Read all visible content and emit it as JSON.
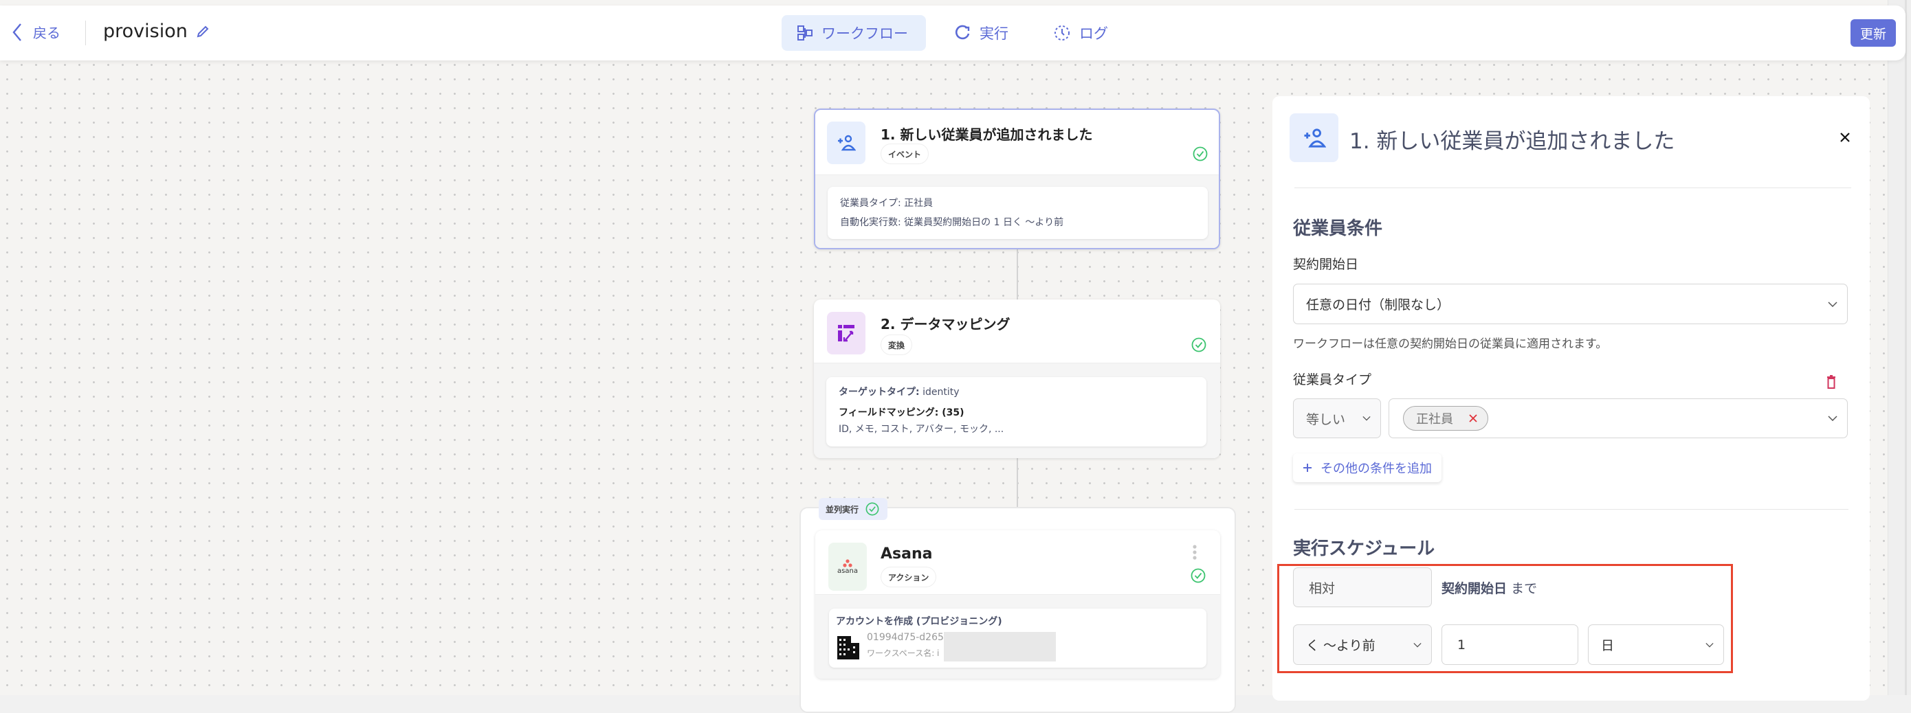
{
  "header": {
    "back_label": "戻る",
    "title": "provision",
    "tabs": [
      {
        "label": "ワークフロー",
        "icon": "workflow-icon"
      },
      {
        "label": "実行",
        "icon": "run-icon"
      },
      {
        "label": "ログ",
        "icon": "log-icon"
      }
    ],
    "update_label": "更新",
    "accent": "#6271d9"
  },
  "nodes": [
    {
      "title": "1. 新しい従業員が追加されました",
      "badge": "イベント",
      "lines": [
        "従業員タイプ: 正社員",
        "自動化実行数: 従業員契約開始日の 1 日く ～より前"
      ]
    },
    {
      "title": "2. データマッピング",
      "badge": "変換",
      "target_label": "ターゲットタイプ:",
      "target_value": "identity",
      "mapping_label": "フィールドマッピング: (35)",
      "mapping_value": "ID, メモ, コスト, アバター, モック, ..."
    }
  ],
  "parallel": {
    "label": "並列実行",
    "app": {
      "logo_text": "asana",
      "title": "Asana",
      "badge": "アクション",
      "action": "アカウントを作成 (プロビジョニング)",
      "id": "01994d75-d265",
      "workspace": "ワークスペース名: i"
    }
  },
  "panel": {
    "title": "1. 新しい従業員が追加されました",
    "conditions_heading": "従業員条件",
    "start_date_label": "契約開始日",
    "start_date_value": "任意の日付（制限なし）",
    "start_date_help": "ワークフローは任意の契約開始日の従業員に適用されます。",
    "type_label": "従業員タイプ",
    "operator_value": "等しい",
    "chips": [
      "正社員"
    ],
    "add_condition_label": "その他の条件を追加",
    "schedule_heading": "実行スケジュール",
    "mode_value": "相対",
    "relative_to": "契約開始日",
    "relative_suffix": "まで",
    "direction_value": "く ～より前",
    "amount_value": "1",
    "unit_value": "日"
  }
}
